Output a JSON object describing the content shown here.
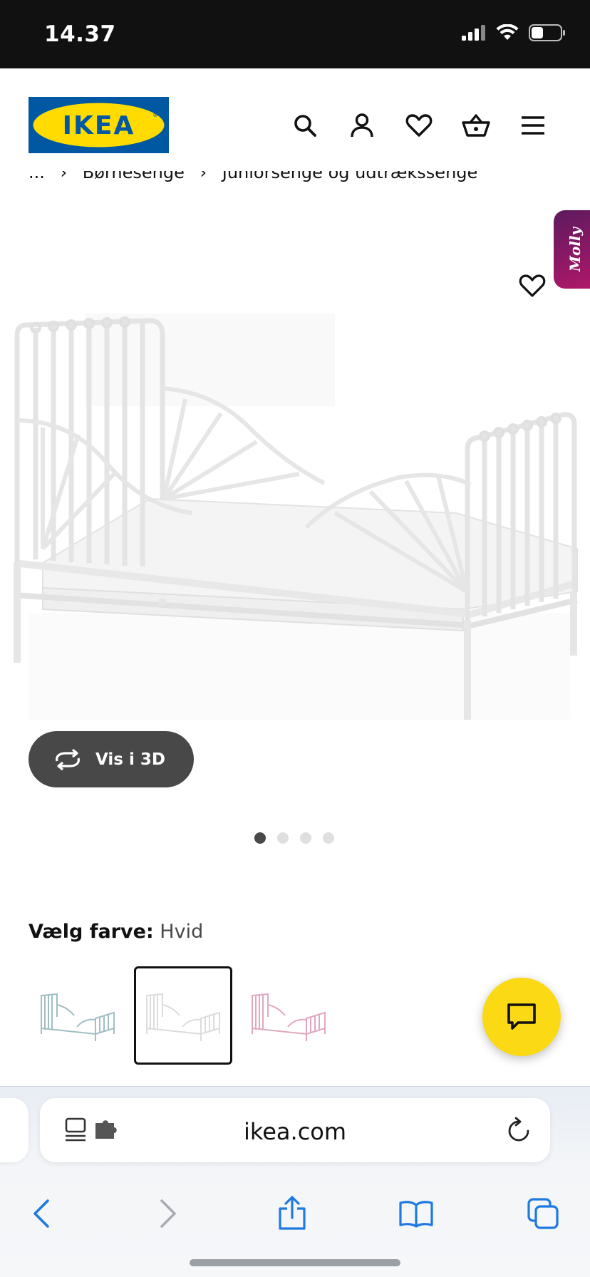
{
  "status": {
    "time": "14.37"
  },
  "header": {
    "logo_text": "IKEA",
    "icons": [
      "search-icon",
      "account-icon",
      "heart-icon",
      "basket-icon",
      "menu-icon"
    ]
  },
  "breadcrumb": [
    "...",
    "Børnesenge",
    "Juniorsenge og udtrækssenge"
  ],
  "gallery": {
    "molly_label": "Molly",
    "view3d_label": "Vis i 3D",
    "dots_total": 4,
    "dots_active_index": 0
  },
  "color_selector": {
    "label": "Vælg farve:",
    "value": "Hvid",
    "options": [
      {
        "name": "light blue",
        "color": "#9fbfc4",
        "selected": false
      },
      {
        "name": "white",
        "color": "#e9e9e9",
        "selected": true
      },
      {
        "name": "pink",
        "color": "#e2a7be",
        "selected": false
      }
    ]
  },
  "colors": {
    "ikea_blue": "#0058a3",
    "ikea_yellow": "#ffdb00",
    "chat_yellow": "#fbd914",
    "browser_blue": "#1f7ae0"
  },
  "browser": {
    "url": "ikea.com",
    "toolbar": [
      "back-icon",
      "forward-icon",
      "share-icon",
      "bookmarks-icon",
      "tabs-icon"
    ]
  }
}
